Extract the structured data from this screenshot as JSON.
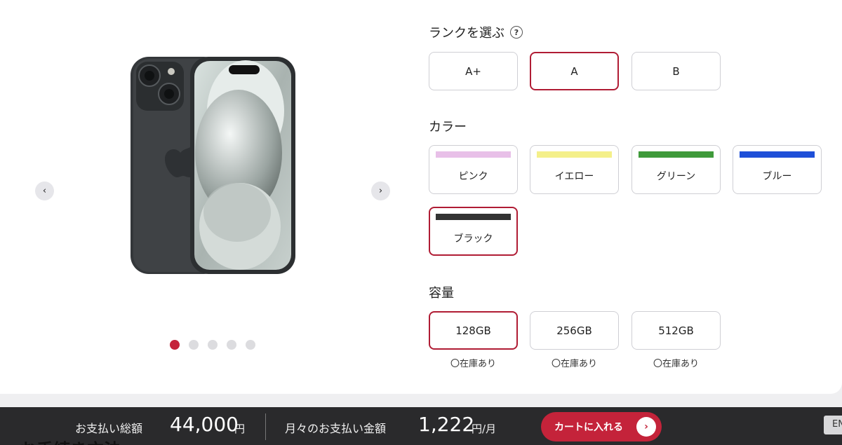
{
  "gallery": {
    "prev_icon": "chevron-left-icon",
    "next_icon": "chevron-right-icon",
    "prev_glyph": "‹",
    "next_glyph": "›",
    "dot_count": 5,
    "active_dot": 1,
    "active_color": "#c4233a"
  },
  "rank": {
    "title": "ランクを選ぶ",
    "help_label": "?",
    "options": [
      "A+",
      "A",
      "B"
    ],
    "selected": "A"
  },
  "color": {
    "title": "カラー",
    "options": [
      {
        "label": "ピンク",
        "swatch": "#e8c0e8"
      },
      {
        "label": "イエロー",
        "swatch": "#f4f08a"
      },
      {
        "label": "グリーン",
        "swatch": "#3f9a3a"
      },
      {
        "label": "ブルー",
        "swatch": "#1e4fd8"
      },
      {
        "label": "ブラック",
        "swatch": "#333333"
      }
    ],
    "selected": "ブラック"
  },
  "capacity": {
    "title": "容量",
    "options": [
      {
        "label": "128GB",
        "stock": "〇在庫あり"
      },
      {
        "label": "256GB",
        "stock": "〇在庫あり"
      },
      {
        "label": "512GB",
        "stock": "〇在庫あり"
      }
    ],
    "selected": "128GB"
  },
  "bottom_bar": {
    "total_label": "お支払い総額",
    "total_amount": "44,000",
    "total_unit": "円",
    "monthly_label": "月々のお支払い金額",
    "monthly_amount": "1,222",
    "monthly_unit": "円/月",
    "cart_label": "カートに入れる",
    "cart_glyph": "›",
    "accent": "#c4233a"
  },
  "language_tab": "EN",
  "next_section_heading": "お手続き方法"
}
